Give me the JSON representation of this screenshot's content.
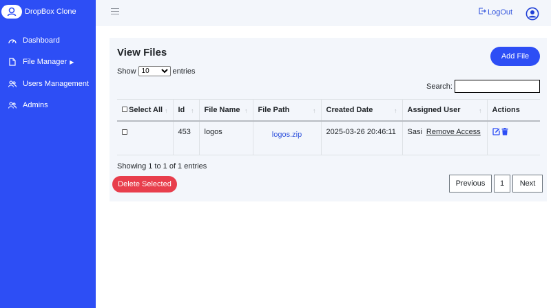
{
  "brand": {
    "name": "DropBox Clone"
  },
  "sidebar": {
    "items": [
      {
        "label": "Dashboard",
        "icon": "dashboard-icon"
      },
      {
        "label": "File Manager",
        "icon": "file-icon",
        "has_caret": true
      },
      {
        "label": "Users Management",
        "icon": "users-icon"
      },
      {
        "label": "Admins",
        "icon": "users-icon"
      }
    ]
  },
  "topbar": {
    "logout_label": "LogOut"
  },
  "main": {
    "title": "View Files",
    "add_button": "Add File",
    "length": {
      "show": "Show",
      "value": "10",
      "entries": "entries"
    },
    "search": {
      "label": "Search:",
      "value": ""
    },
    "table": {
      "headers": {
        "select_all": "Select All",
        "id": "Id",
        "file_name": "File Name",
        "file_path": "File Path",
        "created_date": "Created Date",
        "assigned_user": "Assigned User",
        "actions": "Actions"
      },
      "rows": [
        {
          "id": "453",
          "file_name": "logos",
          "file_path": "logos.zip",
          "created_date": "2025-03-26 20:46:11",
          "assigned_user": "Sasi",
          "remove_access": "Remove Access"
        }
      ]
    },
    "showing": "Showing 1 to 1 of 1 entries",
    "delete_button": "Delete Selected",
    "pagination": {
      "previous": "Previous",
      "page": "1",
      "next": "Next"
    }
  },
  "colors": {
    "primary": "#2d4ef5",
    "danger": "#e83e4c",
    "link": "#3355dd",
    "panel": "#f3f6fb"
  }
}
